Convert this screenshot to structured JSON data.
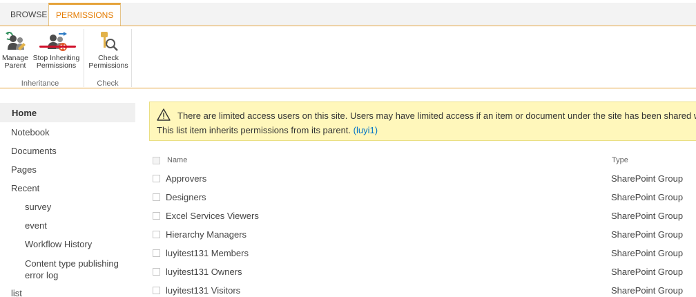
{
  "ribbon": {
    "tabs": [
      {
        "label": "BROWSE"
      },
      {
        "label": "PERMISSIONS"
      }
    ],
    "buttons": {
      "manage_parent": "Manage\nParent",
      "stop_inheriting": "Stop Inheriting\nPermissions",
      "check_permissions": "Check\nPermissions"
    },
    "groups": {
      "inheritance": "Inheritance",
      "check": "Check"
    }
  },
  "nav": {
    "home": "Home",
    "items": [
      "Notebook",
      "Documents",
      "Pages",
      "Recent"
    ],
    "recent_items": [
      "survey",
      "event",
      "Workflow History",
      "Content type publishing\nerror log"
    ],
    "last": "list"
  },
  "banner": {
    "line1": "There are limited access users on this site. Users may have limited access if an item or document under the site has been shared wit",
    "line2_text": "This list item inherits permissions from its parent. ",
    "line2_link": "(luyi1)"
  },
  "table": {
    "headers": {
      "name": "Name",
      "type": "Type"
    },
    "rows": [
      {
        "name": "Approvers",
        "type": "SharePoint Group"
      },
      {
        "name": "Designers",
        "type": "SharePoint Group"
      },
      {
        "name": "Excel Services Viewers",
        "type": "SharePoint Group"
      },
      {
        "name": "Hierarchy Managers",
        "type": "SharePoint Group"
      },
      {
        "name": "luyitest131 Members",
        "type": "SharePoint Group"
      },
      {
        "name": "luyitest131 Owners",
        "type": "SharePoint Group"
      },
      {
        "name": "luyitest131 Visitors",
        "type": "SharePoint Group"
      }
    ]
  },
  "colors": {
    "accent": "#e5a33b",
    "active_tab_text": "#e47b00",
    "banner_bg": "#fff7bb",
    "link": "#0072c6",
    "underline_red": "#d0102a"
  }
}
